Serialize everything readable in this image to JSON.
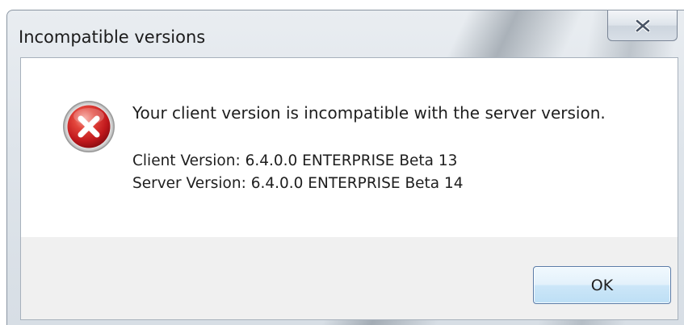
{
  "dialog": {
    "title": "Incompatible versions",
    "message": "Your client version is incompatible with the server version.",
    "client_version": "Client Version: 6.4.0.0 ENTERPRISE Beta 13",
    "server_version": "Server Version: 6.4.0.0 ENTERPRISE Beta 14",
    "ok_label": "OK",
    "icon": "error-icon"
  },
  "colors": {
    "error_red": "#c8191e",
    "button_border": "#5a7ca8"
  }
}
